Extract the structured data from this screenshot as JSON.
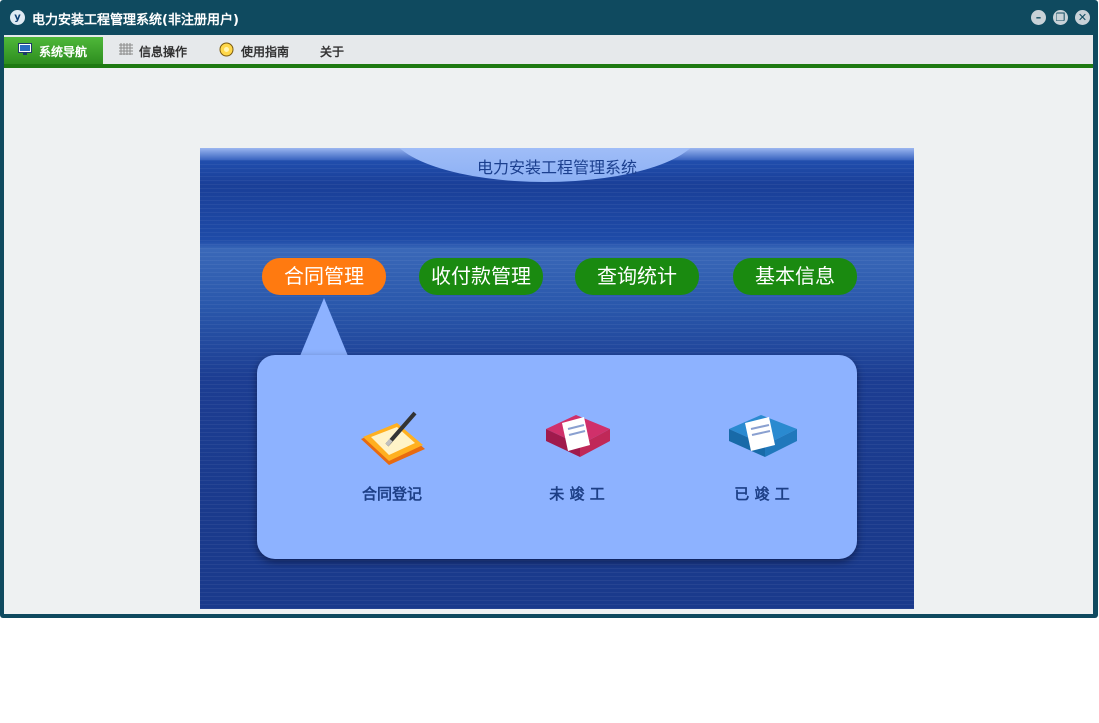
{
  "window": {
    "title": "电力安装工程管理系统(非注册用户)",
    "logo_text": "y",
    "minimize_glyph": "–",
    "maximize_glyph": "❐",
    "close_glyph": "✕"
  },
  "menu": {
    "tabs": [
      {
        "label": "系统导航",
        "icon": "monitor-icon"
      },
      {
        "label": "信息操作",
        "icon": "grid-icon"
      },
      {
        "label": "使用指南",
        "icon": "help-icon"
      },
      {
        "label": "关于",
        "icon": ""
      }
    ]
  },
  "panel": {
    "title": "电力安装工程管理系统",
    "nav": [
      {
        "label": "合同管理",
        "color": "#ff7a10",
        "active": true
      },
      {
        "label": "收付款管理",
        "color": "#1a8a10"
      },
      {
        "label": "查询统计",
        "color": "#1a8a10"
      },
      {
        "label": "基本信息",
        "color": "#1a8a10"
      }
    ],
    "items": [
      {
        "label": "合同登记",
        "icon": "contract-folder-icon"
      },
      {
        "label": "未 竣 工",
        "icon": "red-book-icon"
      },
      {
        "label": "已 竣 工",
        "icon": "blue-book-icon"
      }
    ]
  }
}
